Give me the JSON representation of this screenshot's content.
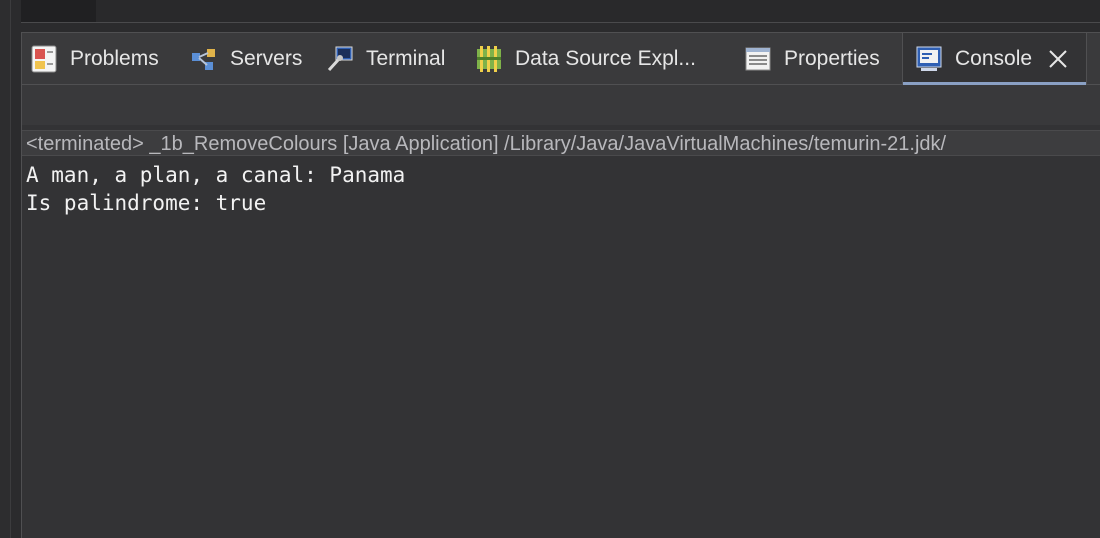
{
  "tabs": [
    {
      "label": "Problems",
      "icon": "problems-icon"
    },
    {
      "label": "Servers",
      "icon": "servers-icon"
    },
    {
      "label": "Terminal",
      "icon": "terminal-icon"
    },
    {
      "label": "Data Source Expl...",
      "icon": "data-source-explorer-icon"
    },
    {
      "label": "Properties",
      "icon": "properties-icon"
    },
    {
      "label": "Console",
      "icon": "console-icon",
      "active": true
    }
  ],
  "console": {
    "status_line": "<terminated> _1b_RemoveColours [Java Application] /Library/Java/JavaVirtualMachines/temurin-21.jdk/",
    "output": [
      "A man, a plan, a canal: Panama",
      "Is palindrome: true"
    ]
  },
  "colors": {
    "background": "#333335",
    "tabbar": "#3a3a3c",
    "active_underline": "#8aa0c4",
    "text": "#e6e6e6"
  }
}
